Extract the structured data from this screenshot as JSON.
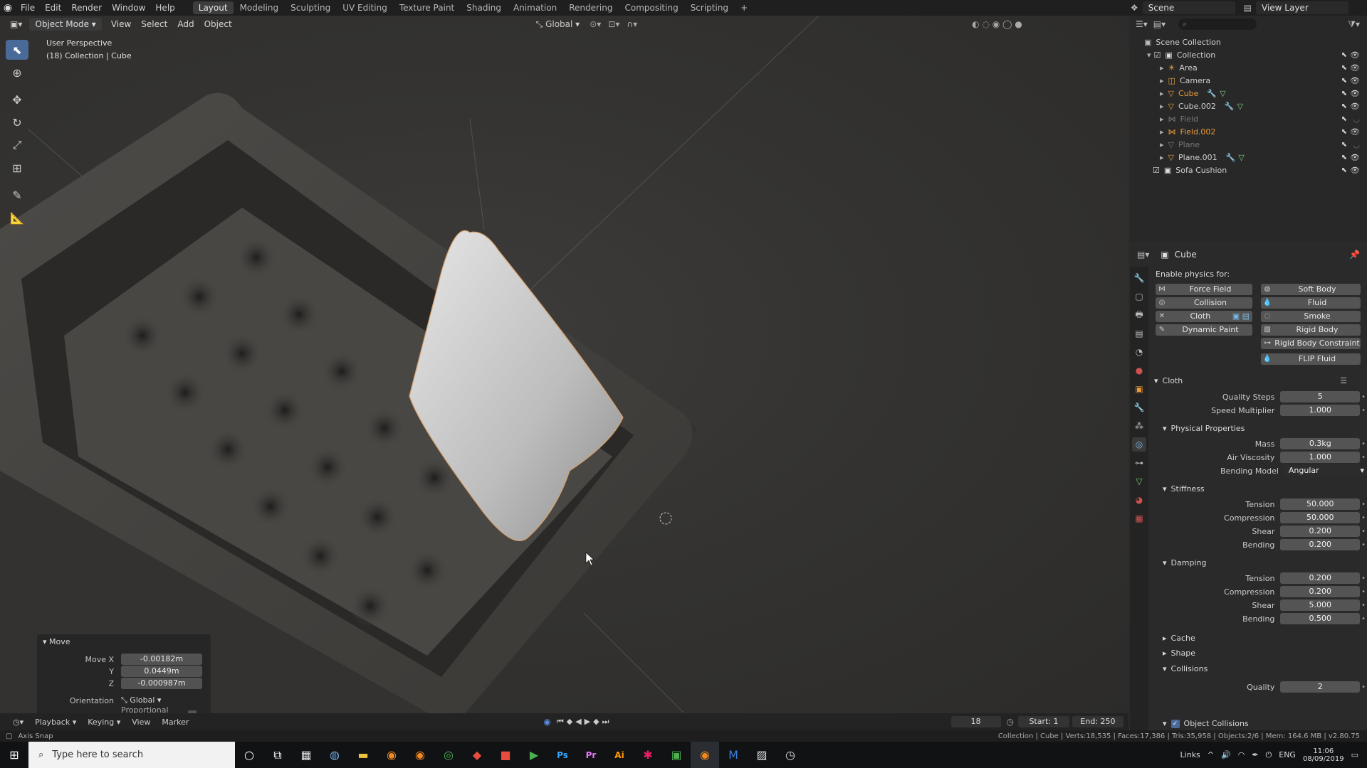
{
  "topbar": {
    "menus": [
      "File",
      "Edit",
      "Render",
      "Window",
      "Help"
    ],
    "workspace_tabs": [
      "Layout",
      "Modeling",
      "Sculpting",
      "UV Editing",
      "Texture Paint",
      "Shading",
      "Animation",
      "Rendering",
      "Compositing",
      "Scripting"
    ],
    "active_tab": "Layout",
    "add_tab": "+",
    "scene": "Scene",
    "view_layer": "View Layer"
  },
  "viewport": {
    "mode": "Object Mode",
    "menus": [
      "View",
      "Select",
      "Add",
      "Object"
    ],
    "orientation": "Global",
    "view_name": "User Perspective",
    "collection_info": "(18) Collection | Cube"
  },
  "move_panel": {
    "title": "Move",
    "move_x_label": "Move X",
    "y_label": "Y",
    "z_label": "Z",
    "move_x": "-0.00182m",
    "y": "0.0449m",
    "z": "-0.000987m",
    "orientation_label": "Orientation",
    "orientation": "Global",
    "proportional_label": "Proportional Editing"
  },
  "timeline": {
    "menus": [
      "Playback",
      "Keying",
      "View",
      "Marker"
    ],
    "current_frame": "18",
    "start_label": "Start:",
    "start": "1",
    "end_label": "End:",
    "end": "250"
  },
  "statusbar": {
    "left": "Axis Snap",
    "right": "Collection | Cube | Verts:18,535 | Faces:17,386 | Tris:35,958 | Objects:2/6 | Mem: 164.6 MB | v2.80.75"
  },
  "outliner": {
    "root": "Scene Collection",
    "collection": "Collection",
    "items": [
      {
        "name": "Area",
        "color": "#d0d0d0"
      },
      {
        "name": "Camera",
        "color": "#d0d0d0"
      },
      {
        "name": "Cube",
        "color": "#e89a3c"
      },
      {
        "name": "Cube.002",
        "color": "#d0d0d0"
      },
      {
        "name": "Field",
        "color": "#777777"
      },
      {
        "name": "Field.002",
        "color": "#e89a3c"
      },
      {
        "name": "Plane",
        "color": "#777777"
      },
      {
        "name": "Plane.001",
        "color": "#d0d0d0"
      }
    ],
    "sofa": "Sofa Cushion"
  },
  "properties": {
    "object_name": "Cube",
    "enable_physics_label": "Enable physics for:",
    "physics_left": [
      "Force Field",
      "Collision",
      "Cloth",
      "Dynamic Paint"
    ],
    "physics_right": [
      "Soft Body",
      "Fluid",
      "Smoke",
      "Rigid Body",
      "Rigid Body Constraint",
      "FLIP Fluid"
    ],
    "cloth": {
      "title": "Cloth",
      "quality_steps_label": "Quality Steps",
      "quality_steps": "5",
      "speed_multiplier_label": "Speed Multiplier",
      "speed_multiplier": "1.000",
      "physical_title": "Physical Properties",
      "mass_label": "Mass",
      "mass": "0.3kg",
      "air_label": "Air Viscosity",
      "air": "1.000",
      "bending_model_label": "Bending Model",
      "bending_model": "Angular",
      "stiffness_title": "Stiffness",
      "stiff_tension_label": "Tension",
      "stiff_tension": "50.000",
      "stiff_compression_label": "Compression",
      "stiff_compression": "50.000",
      "stiff_shear_label": "Shear",
      "stiff_shear": "0.200",
      "stiff_bending_label": "Bending",
      "stiff_bending": "0.200",
      "damping_title": "Damping",
      "damp_tension_label": "Tension",
      "damp_tension": "0.200",
      "damp_compression_label": "Compression",
      "damp_compression": "0.200",
      "damp_shear_label": "Shear",
      "damp_shear": "5.000",
      "damp_bending_label": "Bending",
      "damp_bending": "0.500",
      "cache_title": "Cache",
      "shape_title": "Shape",
      "collisions_title": "Collisions",
      "quality_label": "Quality",
      "quality": "2",
      "object_collisions": "Object Collisions"
    }
  },
  "taskbar": {
    "search_placeholder": "Type here to search",
    "links": "Links",
    "lang": "ENG",
    "time": "11:06",
    "date": "08/09/2019"
  },
  "colors": {
    "accent_blue": "#4a6a9a",
    "active_orange": "#e89a3c"
  }
}
